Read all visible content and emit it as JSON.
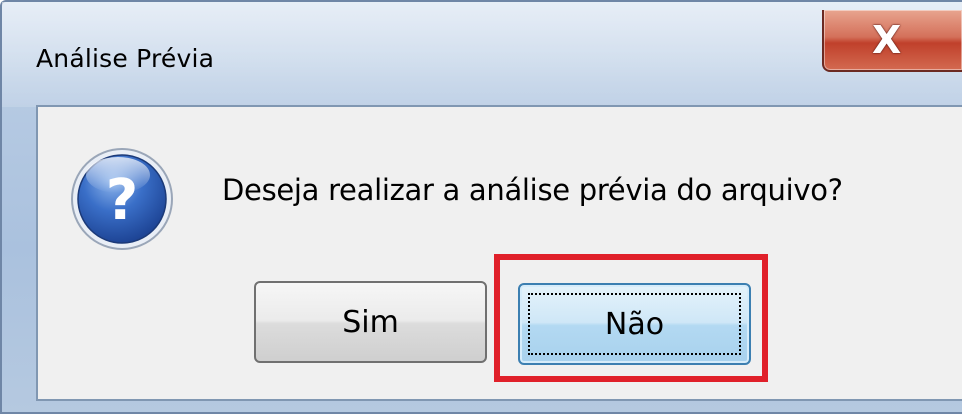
{
  "window": {
    "title": "Análise Prévia",
    "close_glyph": "X"
  },
  "dialog": {
    "icon": "question-icon",
    "message": "Deseja realizar a análise prévia do arquivo?",
    "buttons": {
      "yes_label": "Sim",
      "no_label": "Não"
    }
  },
  "colors": {
    "highlight": "#e0202a",
    "question_icon": "#2f63b8"
  }
}
